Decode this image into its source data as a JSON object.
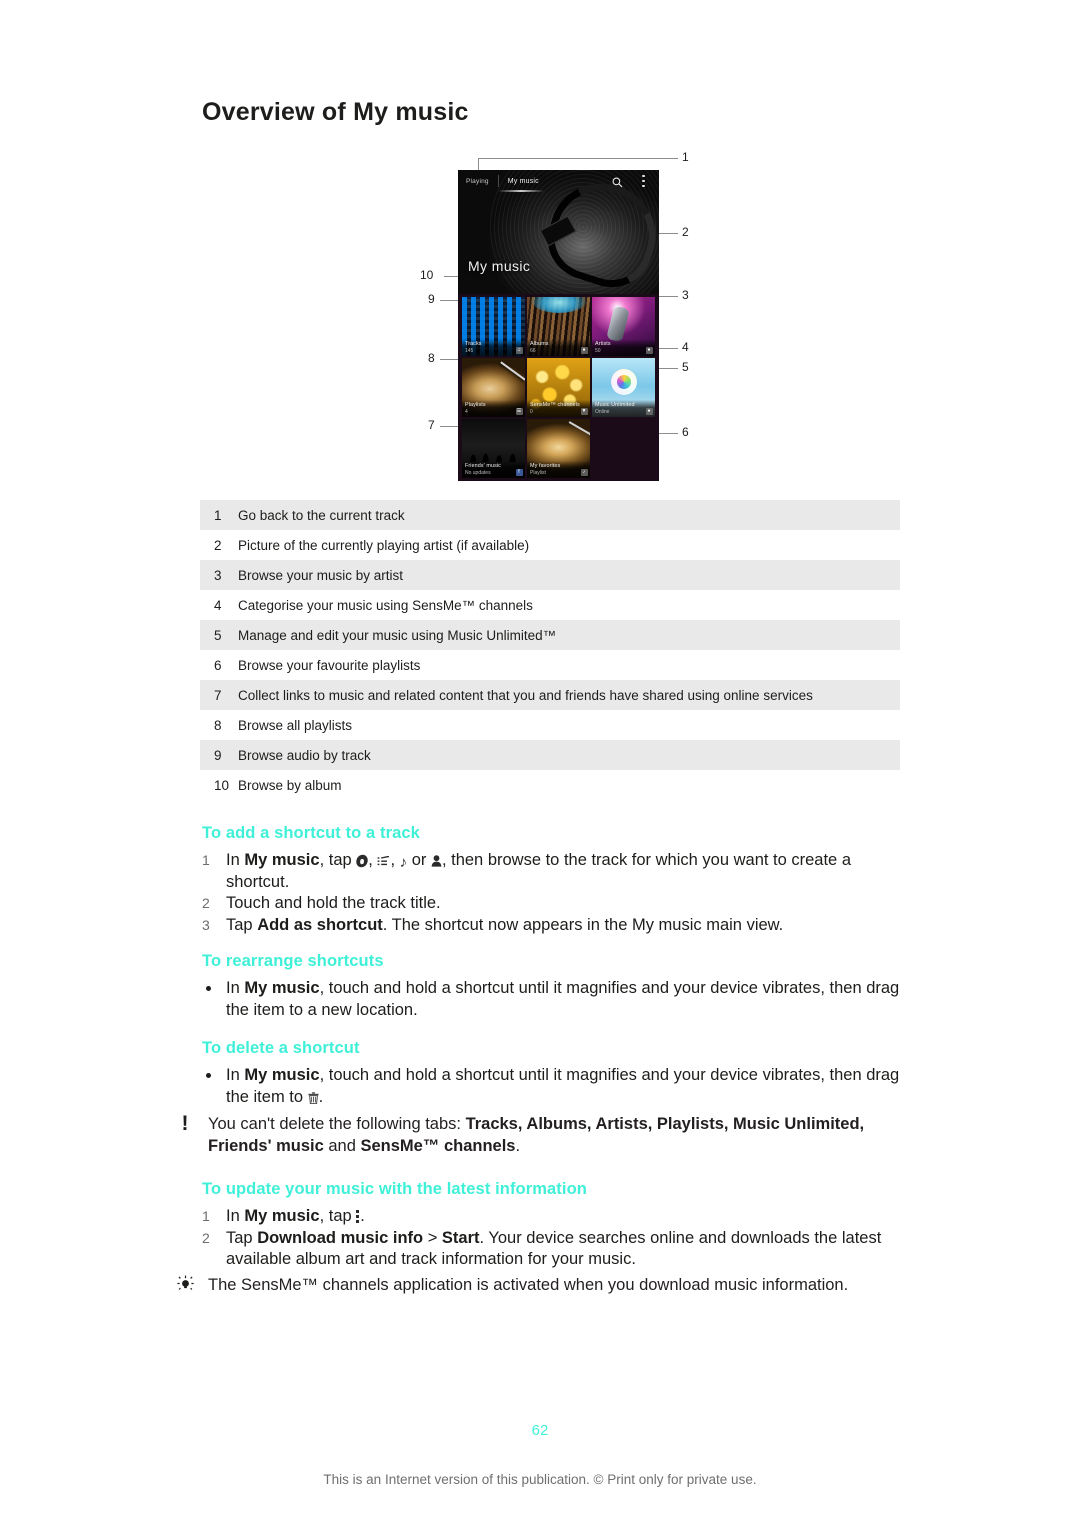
{
  "document": {
    "title": "Overview of My music",
    "page_number": "62",
    "footer": "This is an Internet version of this publication. © Print only for private use."
  },
  "colors": {
    "heading_accent": "#3ff0d8",
    "table_stripe": "#e9e9e9",
    "body_text": "#1d1d1b"
  },
  "figure": {
    "name": "my-music-screen-illustration",
    "phone_ui": {
      "tab_playing": "Playing",
      "tab_my_music": "My music",
      "search_icon": "search-icon",
      "more_icon": "overflow-menu-icon",
      "hero_label": "My music",
      "tiles": [
        {
          "name": "Tracks",
          "sub": "145",
          "badge": "♫",
          "badge_name": "music-note-badge-icon"
        },
        {
          "name": "Albums",
          "sub": "66",
          "badge": "●",
          "badge_name": "album-disc-badge-icon"
        },
        {
          "name": "Artists",
          "sub": "50",
          "badge": "●",
          "badge_name": "artist-person-badge-icon"
        },
        {
          "name": "Playlists",
          "sub": "4",
          "badge": "☰",
          "badge_name": "playlist-badge-icon"
        },
        {
          "name": "SensMe™ channels",
          "sub": "0",
          "badge": "▼",
          "badge_name": "sensme-badge-icon"
        },
        {
          "name": "Music Unlimited",
          "sub": "Online",
          "badge": "●",
          "badge_name": "music-unlimited-badge-icon"
        },
        {
          "name": "Friends' music",
          "sub": "No updates",
          "badge": "f",
          "badge_name": "facebook-badge-icon"
        },
        {
          "name": "My favorites",
          "sub": "Playlist",
          "badge": "♪",
          "badge_name": "favorites-badge-icon"
        }
      ]
    },
    "callouts": [
      "1",
      "2",
      "3",
      "4",
      "5",
      "6",
      "7",
      "8",
      "9",
      "10"
    ]
  },
  "legend": {
    "rows": [
      {
        "num": "1",
        "text": "Go back to the current track"
      },
      {
        "num": "2",
        "text": "Picture of the currently playing artist (if available)"
      },
      {
        "num": "3",
        "text": "Browse your music by artist"
      },
      {
        "num": "4",
        "text": "Categorise your music using SensMe™ channels"
      },
      {
        "num": "5",
        "text": "Manage and edit your music using Music Unlimited™"
      },
      {
        "num": "6",
        "text": "Browse your favourite playlists"
      },
      {
        "num": "7",
        "text": "Collect links to music and related content that you and friends have shared using online services"
      },
      {
        "num": "8",
        "text": "Browse all playlists"
      },
      {
        "num": "9",
        "text": "Browse audio by track"
      },
      {
        "num": "10",
        "text": "Browse by album"
      }
    ]
  },
  "sections": {
    "add_shortcut": {
      "heading": "To add a shortcut to a track",
      "step1_a": "In ",
      "step1_b": "My music",
      "step1_c": ", tap ",
      "step1_sep1": ", ",
      "step1_sep2": ", ",
      "step1_or": " or ",
      "step1_d": ", then browse to the track for which you want to create a shortcut.",
      "step2": "Touch and hold the track title.",
      "step3_a": "Tap ",
      "step3_b": "Add as shortcut",
      "step3_c": ". The shortcut now appears in the My music main view.",
      "markers": [
        "1",
        "2",
        "3"
      ]
    },
    "rearrange": {
      "heading": "To rearrange shortcuts",
      "bullet_a": "In ",
      "bullet_b": "My music",
      "bullet_c": ", touch and hold a shortcut until it magnifies and your device vibrates, then drag the item to a new location."
    },
    "delete": {
      "heading": "To delete a shortcut",
      "bullet_a": "In ",
      "bullet_b": "My music",
      "bullet_c": ", touch and hold a shortcut until it magnifies and your device vibrates, then drag the item to ",
      "bullet_d": "."
    },
    "note_cannot_delete": {
      "icon": "exclamation-icon",
      "text_a": "You can't delete the following tabs: ",
      "text_b": "Tracks, Albums, Artists, Playlists, Music Unlimited,",
      "text_c": " ",
      "text_d": "Friends' music",
      "text_e": " and ",
      "text_f": "SensMe™ channels",
      "text_g": "."
    },
    "update_music": {
      "heading": "To update your music with the latest information",
      "step1_a": "In ",
      "step1_b": "My music",
      "step1_c": ", tap ",
      "step1_d": ".",
      "step2_a": "Tap ",
      "step2_b": "Download music info",
      "step2_c": " > ",
      "step2_d": "Start",
      "step2_e": ". Your device searches online and downloads the latest available album art and track information for your music.",
      "markers": [
        "1",
        "2"
      ]
    },
    "tip_sensme": {
      "icon": "lightbulb-icon",
      "text": "The SensMe™ channels application is activated when you download music information."
    }
  }
}
